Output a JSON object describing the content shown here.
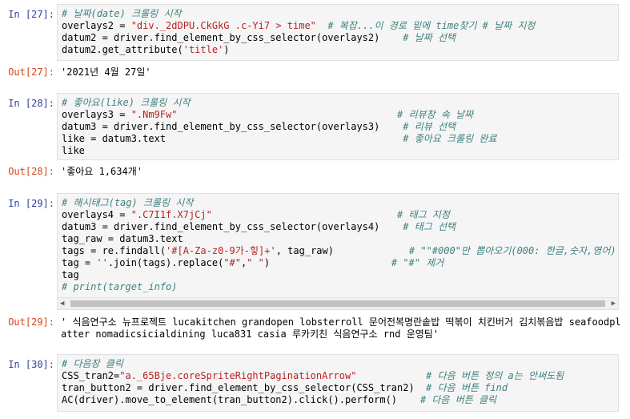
{
  "cells": [
    {
      "prompt": "In [27]:",
      "lines": [
        "<span class=\"c\"># 날짜(date) 크롤링 시작</span>",
        "overlays2 = <span class=\"s\">\"div._2dDPU.CkGkG .c-Yi7 > time\"</span>  <span class=\"c\"># 복잡...이 경로 밑에 time찾기 # 날짜 지정</span>",
        "datum2 = driver.find_element_by_css_selector(overlays2)    <span class=\"c\"># 날짜 선택</span>",
        "datum2.get_attribute(<span class=\"s\">'title'</span>)"
      ]
    },
    {
      "prompt": "In [28]:",
      "lines": [
        "<span class=\"c\"># 좋아요(like) 크롤링 시작</span>",
        "overlays3 = <span class=\"s\">\".Nm9Fw\"</span>                                      <span class=\"c\"># 리뷰창 속 날짜</span>",
        "datum3 = driver.find_element_by_css_selector(overlays3)    <span class=\"c\"># 리뷰 선택</span>",
        "like = datum3.text                                         <span class=\"c\"># 좋아요 크롤링 완료</span>",
        "like"
      ]
    },
    {
      "prompt": "In [29]:",
      "lines": [
        "<span class=\"c\"># 해시태그(tag) 크롤링 시작</span>",
        "overlays4 = <span class=\"s\">\".C7I1f.X7jCj\"</span>                                <span class=\"c\"># 태그 지정</span>",
        "datum3 = driver.find_element_by_css_selector(overlays4)    <span class=\"c\"># 태그 선택</span>",
        "tag_raw = datum3.text",
        "tags = re.findall(<span class=\"s\">'#[A-Za-z0-9가-힣]+'</span>, tag_raw)             <span class=\"c\"># \"\"#000\"만 뽑아오기(000: 한글,숫자,영어)</span>",
        "tag = <span class=\"s\">''</span>.join(tags).replace(<span class=\"s\">\"#\"</span>,<span class=\"s\">\" \"</span>)                     <span class=\"c\"># \"#\" 제거</span>",
        "tag",
        "<span class=\"c\"># print(target_info)</span>"
      ]
    },
    {
      "prompt": "In [30]:",
      "lines": [
        "<span class=\"c\"># 다음장 클릭</span>",
        "CSS_tran2=<span class=\"s\">\"a._65Bje.coreSpriteRightPaginationArrow\"</span>            <span class=\"c\"># 다음 버튼 정의 a는 안써도됨</span>",
        "tran_button2 = driver.find_element_by_css_selector(CSS_tran2)  <span class=\"c\"># 다음 버튼 find</span>",
        "AC(driver).move_to_element(tran_button2).click().perform()    <span class=\"c\"># 다음 버튼 클릭</span>"
      ]
    }
  ],
  "outputs": [
    {
      "prompt": "Out[27]:",
      "text": "'2021년 4월 27일'"
    },
    {
      "prompt": "Out[28]:",
      "text": "'좋아요 1,634개'"
    },
    {
      "prompt": "Out[29]:",
      "text": "' 식음연구소 뉴프로젝트 lucakitchen grandopen lobsterroll 문어전복명란솥밥 떡볶이 치킨버거 김치볶음밥 seafoodplatter nomadicsicialdining luca831 casia 루카키친 식음연구소 rnd 운영팀'"
    }
  ],
  "scrollbar": {
    "left_arrow": "◀",
    "right_arrow": "▶"
  }
}
